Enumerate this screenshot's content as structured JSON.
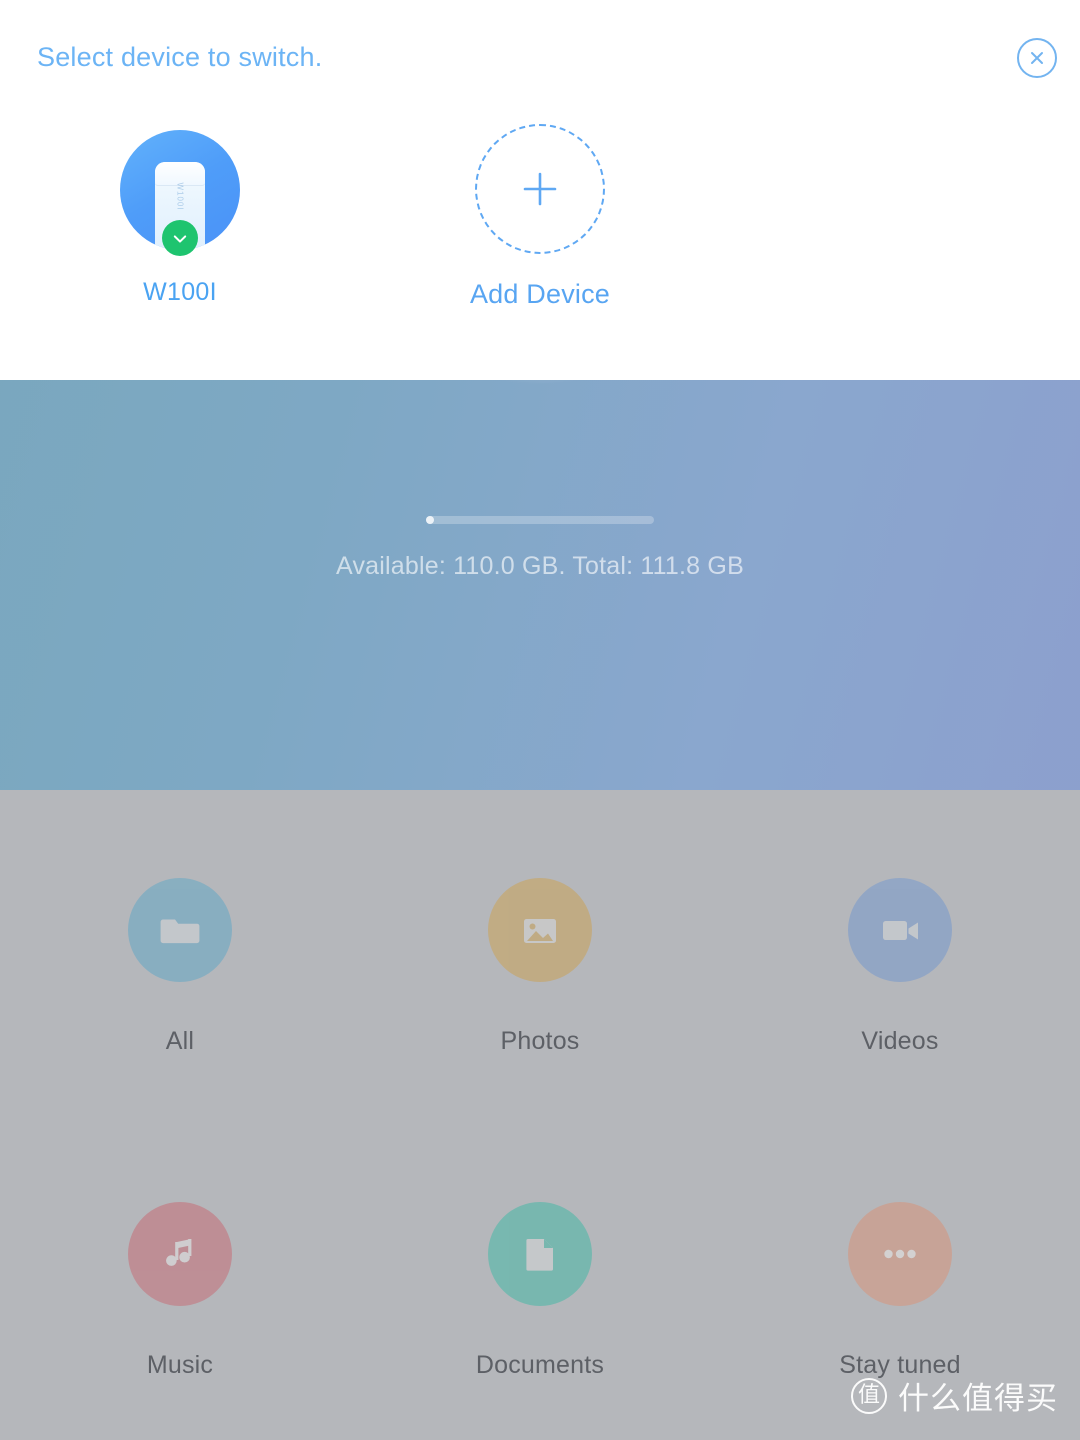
{
  "sheet": {
    "title": "Select device to switch.",
    "close_icon": "close-circle-icon",
    "devices": [
      {
        "name": "W100I",
        "icon": "usb-drive-icon",
        "brand_text": "W100I",
        "selected": true,
        "badge_icon": "check-badge-icon"
      }
    ],
    "add_device": {
      "label": "Add Device",
      "icon": "plus-icon"
    }
  },
  "background": {
    "device_icon": "usb-drive-blurred-icon",
    "storage_text": "Available: 110.0 GB. Total: 111.8 GB",
    "storage_available_gb": 110.0,
    "storage_total_gb": 111.8,
    "storage_used_percent": 1.6
  },
  "categories": [
    {
      "label": "All",
      "icon": "folder-icon",
      "color": "#6da9c4"
    },
    {
      "label": "Photos",
      "icon": "image-icon",
      "color": "#c8a463"
    },
    {
      "label": "Videos",
      "icon": "video-icon",
      "color": "#7e9ccb"
    },
    {
      "label": "Music",
      "icon": "music-note-icon",
      "color": "#c4767f"
    },
    {
      "label": "Documents",
      "icon": "document-icon",
      "color": "#53b8a9"
    },
    {
      "label": "Stay tuned",
      "icon": "ellipsis-icon",
      "color": "#d39882"
    }
  ],
  "watermark": {
    "badge": "值",
    "text": "什么值得买"
  },
  "colors": {
    "accent_blue": "#4aa3f2",
    "title_blue": "#6cb4f5",
    "check_green": "#1ec46f",
    "gray_panel": "#b5b7bb",
    "label_gray": "#5d6066"
  }
}
